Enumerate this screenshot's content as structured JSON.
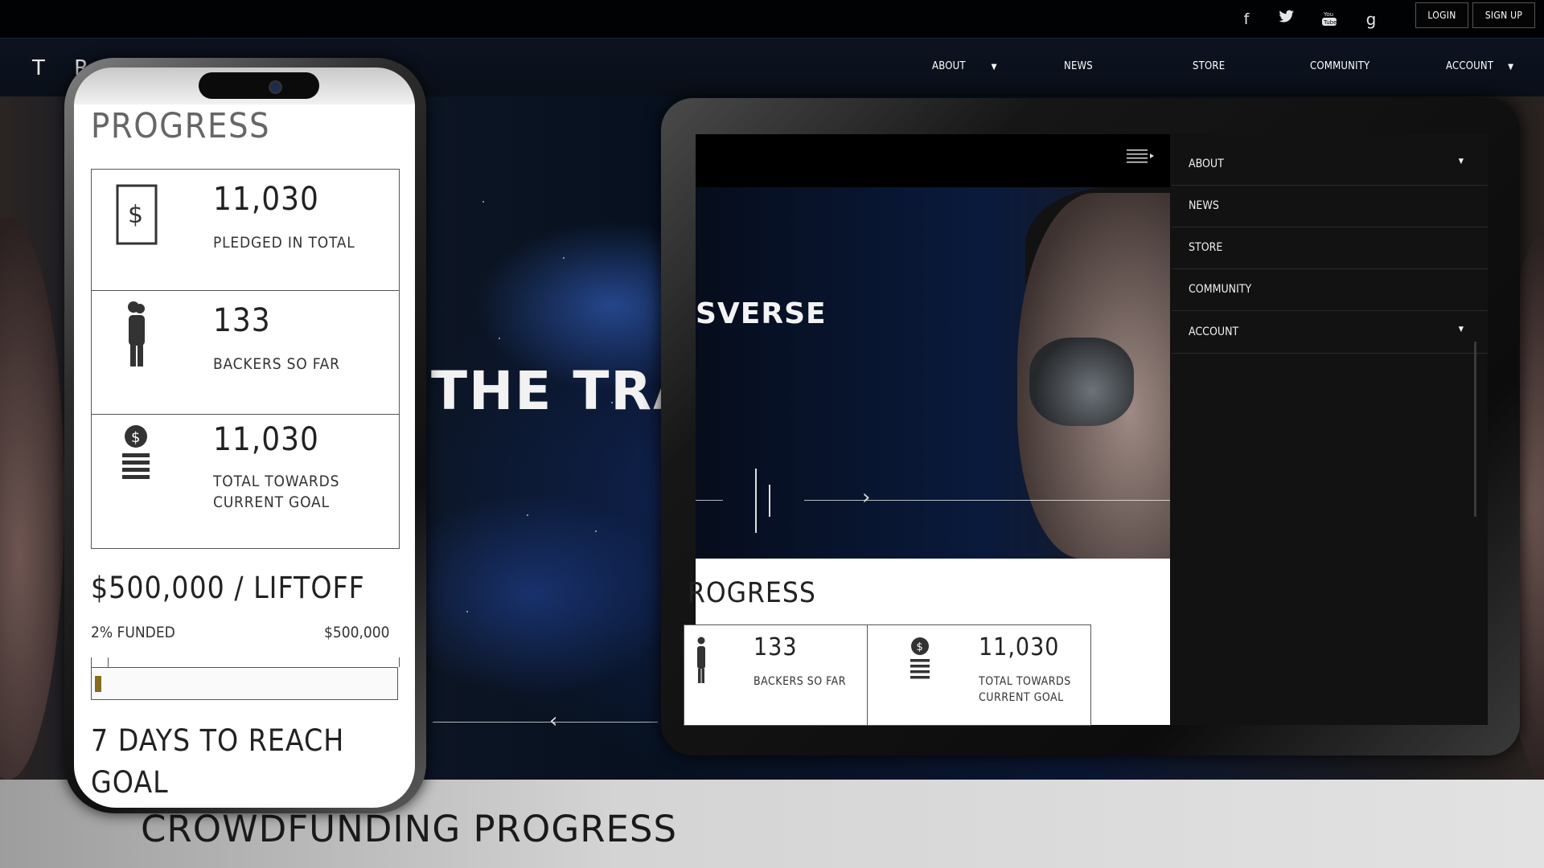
{
  "topbar": {
    "social": [
      "facebook-icon",
      "twitter-icon",
      "youtube-icon",
      "google-icon"
    ],
    "login_label": "LOGIN",
    "signup_label": "SIGN UP"
  },
  "nav": {
    "logo": "T R",
    "items": [
      {
        "label": "ABOUT",
        "has_dropdown": true
      },
      {
        "label": "NEWS",
        "has_dropdown": false
      },
      {
        "label": "STORE",
        "has_dropdown": false
      },
      {
        "label": "COMMUNITY",
        "has_dropdown": false
      },
      {
        "label": "ACCOUNT",
        "has_dropdown": true
      }
    ]
  },
  "hero": {
    "title": "THE TRAN"
  },
  "phone": {
    "heading": "PROGRESS",
    "cards": [
      {
        "icon": "dollar-card-icon",
        "value": "11,030",
        "label": "PLEDGED IN TOTAL"
      },
      {
        "icon": "person-icon",
        "value": "133",
        "label": "BACKERS SO FAR"
      },
      {
        "icon": "coin-stack-icon",
        "value": "11,030",
        "label_line1": "TOTAL TOWARDS",
        "label_line2": "CURRENT GOAL"
      }
    ],
    "goal_title": "$500,000 / LIFTOFF",
    "funded_label": "2% FUNDED",
    "goal_amount": "$500,000",
    "funded_fraction": 0.02,
    "days_line1": "7 DAYS TO REACH",
    "days_line2": "GOAL"
  },
  "tablet": {
    "hero_text": "SVERSE",
    "progress_heading": "ROGRESS",
    "cards": [
      {
        "icon": "person-icon",
        "value": "133",
        "label": "BACKERS SO FAR"
      },
      {
        "icon": "coin-stack-icon",
        "value": "11,030",
        "label_line1": "TOTAL TOWARDS",
        "label_line2": "CURRENT GOAL"
      }
    ],
    "menu": [
      {
        "label": "ABOUT",
        "has_dropdown": true
      },
      {
        "label": "NEWS",
        "has_dropdown": false
      },
      {
        "label": "STORE",
        "has_dropdown": false
      },
      {
        "label": "COMMUNITY",
        "has_dropdown": false
      },
      {
        "label": "ACCOUNT",
        "has_dropdown": true
      }
    ]
  },
  "section": {
    "title": "CROWDFUNDING PROGRESS"
  },
  "colors": {
    "progress_fill": "#8a6a1e",
    "menu_bg": "#121212",
    "topbar_bg": "#010204"
  }
}
